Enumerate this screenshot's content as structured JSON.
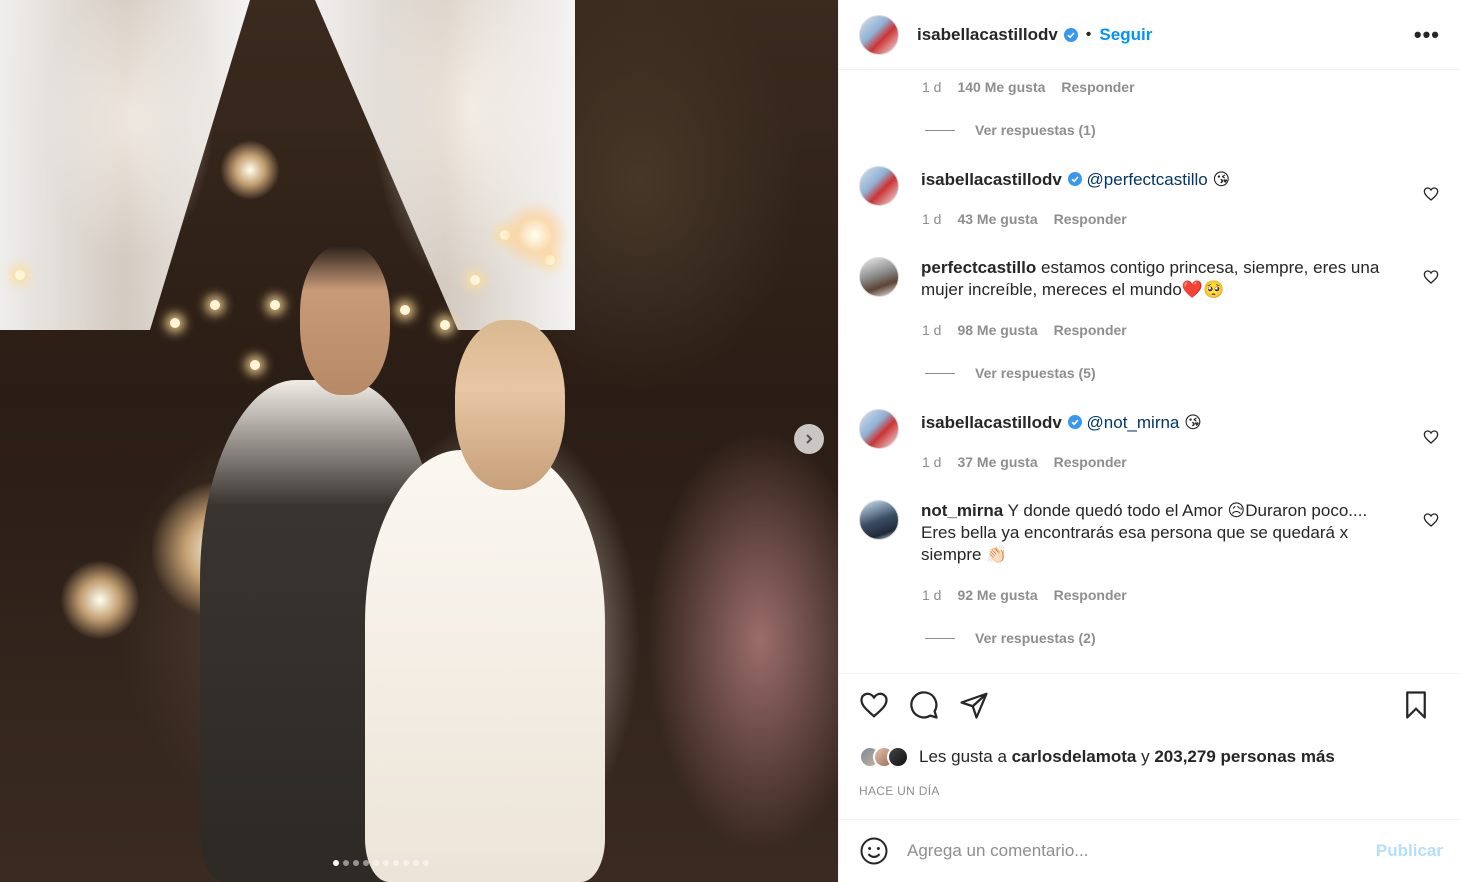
{
  "header": {
    "username": "isabellacastillodv",
    "separator": "•",
    "follow_label": "Seguir",
    "more_label": "•••"
  },
  "comments": [
    {
      "kind": "meta-only",
      "time": "1 d",
      "likes": "140 Me gusta",
      "reply_label": "Responder",
      "view_replies": "Ver respuestas (1)"
    },
    {
      "username": "isabellacastillodv",
      "mention": "@perfectcastillo",
      "text": "",
      "emoji": "😘",
      "time": "1 d",
      "likes": "43 Me gusta",
      "reply_label": "Responder"
    },
    {
      "username": "perfectcastillo",
      "text": "estamos contigo princesa, siempre, eres una mujer increíble, mereces el mundo",
      "emoji": "❤️🥺",
      "time": "1 d",
      "likes": "98 Me gusta",
      "reply_label": "Responder",
      "view_replies": "Ver respuestas (5)"
    },
    {
      "username": "isabellacastillodv",
      "mention": "@not_mirna",
      "text": "",
      "emoji": "😘",
      "time": "1 d",
      "likes": "37 Me gusta",
      "reply_label": "Responder"
    },
    {
      "username": "not_mirna",
      "text_a": "Y donde quedó todo el Amor",
      "emoji_a": "😥",
      "text_b": "Duraron poco.... Eres bella ya encontrarás esa persona que se quedará x siempre",
      "emoji_b": "👏🏻",
      "time": "1 d",
      "likes": "92 Me gusta",
      "reply_label": "Responder",
      "view_replies": "Ver respuestas (2)"
    }
  ],
  "likes": {
    "prefix": "Les gusta a",
    "user": "carlosdelamota",
    "connector": "y",
    "others": "203,279 personas más"
  },
  "time_ago": "HACE UN DÍA",
  "add_comment": {
    "placeholder": "Agrega un comentario...",
    "publish_label": "Publicar"
  },
  "carousel": {
    "total": 10,
    "active": 1
  },
  "colors": {
    "accent": "#0095f6",
    "mention": "#00376b",
    "muted": "#8e8e8e",
    "publish_disabled": "#b2dffc"
  },
  "icons": [
    "verified-icon",
    "heart-icon",
    "comment-icon",
    "share-icon",
    "bookmark-icon",
    "emoji-icon",
    "chevron-right-icon"
  ]
}
